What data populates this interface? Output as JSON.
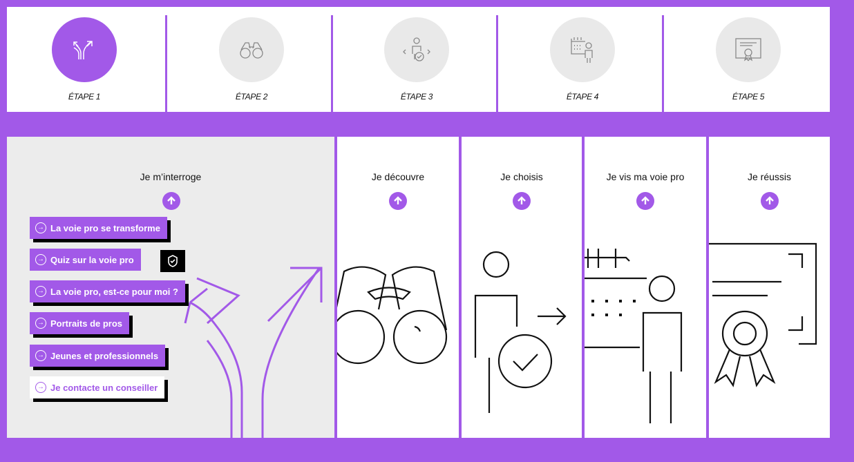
{
  "steps": [
    {
      "label": "ÉTAPE 1",
      "icon": "crossroads-arrows-icon",
      "active": true
    },
    {
      "label": "ÉTAPE 2",
      "icon": "binoculars-icon",
      "active": false
    },
    {
      "label": "ÉTAPE 3",
      "icon": "person-choice-icon",
      "active": false
    },
    {
      "label": "ÉTAPE 4",
      "icon": "calendar-person-icon",
      "active": false
    },
    {
      "label": "ÉTAPE 5",
      "icon": "diploma-certificate-icon",
      "active": false
    }
  ],
  "panels": [
    {
      "title": "Je m’interroge"
    },
    {
      "title": "Je découvre"
    },
    {
      "title": "Je choisis"
    },
    {
      "title": "Je vis ma voie pro"
    },
    {
      "title": "Je réussis"
    }
  ],
  "links": [
    {
      "label": "La voie pro se transforme"
    },
    {
      "label": "Quiz sur la voie pro"
    },
    {
      "label": "La voie pro, est-ce pour moi ?"
    },
    {
      "label": "Portraits de pros"
    },
    {
      "label": "Jeunes et professionnels"
    },
    {
      "label": "Je contacte un conseiller"
    }
  ],
  "colors": {
    "accent": "#a259e8",
    "panel_bg": "#ececec",
    "step_circle": "#e9e9e9"
  }
}
